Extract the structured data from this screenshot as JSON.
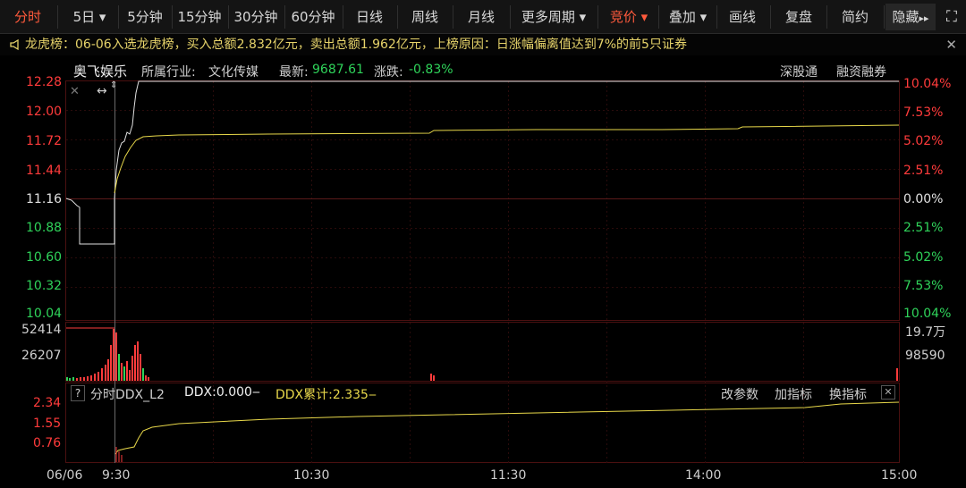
{
  "toolbar": {
    "items": [
      "分时",
      "5日",
      "5分钟",
      "15分钟",
      "30分钟",
      "60分钟",
      "日线",
      "周线",
      "月线",
      "更多周期",
      "竞价",
      "叠加",
      "画线",
      "复盘",
      "简约",
      "隐藏"
    ],
    "dropdown_marker": "▾",
    "more_marker": "▸▸"
  },
  "notice": {
    "text": "龙虎榜：06-06入选龙虎榜，买入总额2.832亿元，卖出总额1.962亿元，上榜原因：日涨幅偏离值达到7%的前5只证券",
    "close": "✕"
  },
  "header": {
    "stock_name": "奥飞娱乐",
    "industry_label": "所属行业:",
    "industry": "文化传媒",
    "latest_label": "最新:",
    "latest": "9687.61",
    "change_label": "涨跌:",
    "change": "-0.83%",
    "link1": "深股通",
    "link2": "融资融券"
  },
  "price_axis": {
    "left": [
      "12.28",
      "12.00",
      "11.72",
      "11.44",
      "11.16",
      "10.88",
      "10.60",
      "10.32",
      "10.04"
    ],
    "right": [
      "10.04%",
      "7.53%",
      "5.02%",
      "2.51%",
      "0.00%",
      "2.51%",
      "5.02%",
      "7.53%",
      "10.04%"
    ]
  },
  "volume_axis": {
    "left": [
      "52414",
      "26207"
    ],
    "right": [
      "19.7万",
      "98590"
    ]
  },
  "indicator": {
    "question": "?",
    "name": "分时DDX_L2",
    "ddx": "DDX:0.000",
    "ddx_sum": "DDX累计:2.335",
    "btn_params": "改参数",
    "btn_add": "加指标",
    "btn_switch": "换指标",
    "close": "✕",
    "axis": [
      "2.34",
      "1.55",
      "0.76"
    ]
  },
  "time_axis": [
    "06/06",
    "9:30",
    "10:30",
    "11:30",
    "14:00",
    "15:00"
  ],
  "colors": {
    "up": "#ff3b3b",
    "down": "#2fd35a",
    "avg": "#e8d84a",
    "price": "#e0e0e0",
    "grid": "#2c0d0d"
  },
  "chart_data": {
    "type": "line",
    "series": [
      {
        "name": "",
        "x": [
          "06/05 open",
          "06/05 close",
          "06/06 9:30",
          "9:35",
          "9:40",
          "10:30",
          "11:30",
          "14:00",
          "15:00"
        ],
        "values": [
          11.16,
          10.73,
          11.16,
          12.04,
          12.28,
          12.28,
          12.28,
          12.28,
          12.28
        ]
      },
      {
        "name": "",
        "x": [
          "06/06 9:30",
          "9:35",
          "9:40",
          "10:00",
          "10:30",
          "11:30",
          "14:00",
          "15:00"
        ],
        "values": [
          11.16,
          11.6,
          11.76,
          11.77,
          11.77,
          11.8,
          11.81,
          11.85
        ]
      }
    ],
    "ylim": [
      10.04,
      12.28
    ]
  }
}
